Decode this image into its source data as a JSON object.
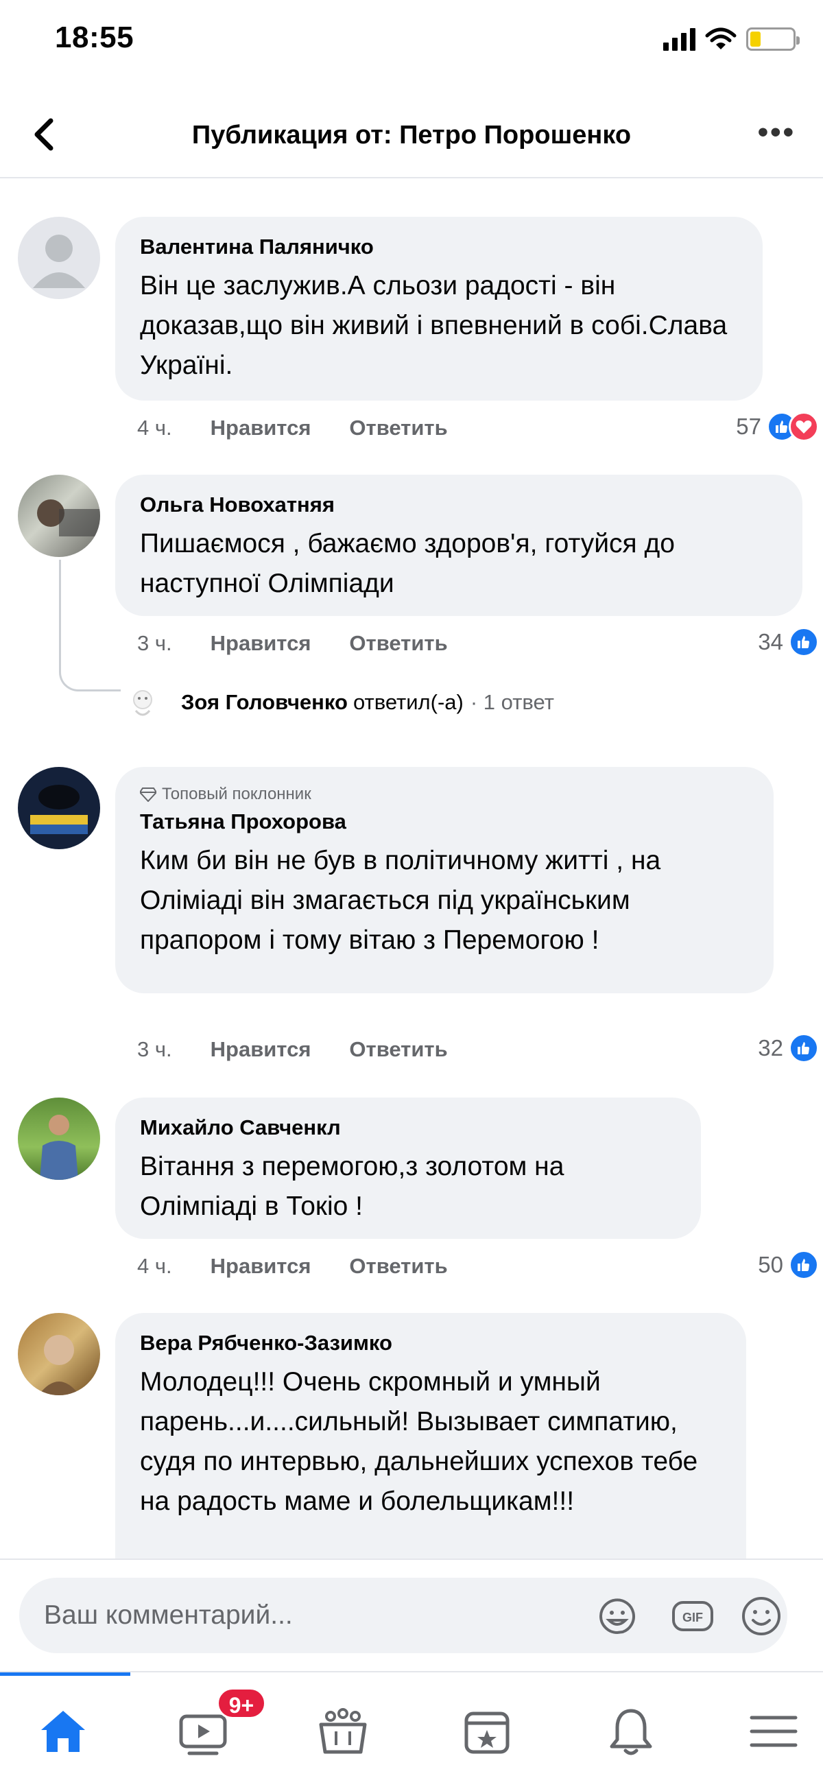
{
  "status_bar": {
    "time": "18:55",
    "battery_level": 0.25
  },
  "header": {
    "title": "Публикация от: Петро Порошенко"
  },
  "comments": [
    {
      "author": "Валентина Паляничко",
      "text": "Він це заслужив.А сльози радості - він доказав,що він живий і впевнений в собі.Слава Україні.",
      "time": "4 ч.",
      "like_label": "Нравится",
      "reply_label": "Ответить",
      "reactions": {
        "count": "57",
        "types": [
          "like",
          "love"
        ]
      }
    },
    {
      "author": "Ольга Новохатняя",
      "text": "Пишаємося  , бажаємо здоров'я, готуйся до наступної Олімпіади",
      "time": "3 ч.",
      "like_label": "Нравится",
      "reply_label": "Ответить",
      "reactions": {
        "count": "34",
        "types": [
          "like"
        ]
      },
      "reply_summary": {
        "name": "Зоя Головченко",
        "verb": "ответил(-а)",
        "count": "· 1 ответ"
      }
    },
    {
      "badge": "Топовый поклонник",
      "author": "Татьяна Прохорова",
      "text": "Ким би він не був в політичному житті , на Оліміаді він змагається під українським прапором і тому вітаю з Перемогою !",
      "time": "3 ч.",
      "like_label": "Нравится",
      "reply_label": "Ответить",
      "reactions": {
        "count": "32",
        "types": [
          "like"
        ]
      }
    },
    {
      "author": "Михайло Савченкл",
      "text": "Вітання з перемогою,з золотом на Олімпіаді в Токіо !",
      "time": "4 ч.",
      "like_label": "Нравится",
      "reply_label": "Ответить",
      "reactions": {
        "count": "50",
        "types": [
          "like"
        ]
      }
    },
    {
      "author": "Вера Рябченко-Зазимко",
      "text": "Молодец!!! Очень скромный и умный парень...и....сильный! Вызывает симпатию, судя по интервью, дальнейших успехов тебе на радость маме и болельщикам!!!"
    }
  ],
  "composer": {
    "placeholder": "Ваш комментарий...",
    "icons": [
      "sticker-icon",
      "gif-icon",
      "emoji-icon"
    ],
    "gif_label": "GIF"
  },
  "tabbar": {
    "tabs": [
      "home-icon",
      "video-icon",
      "groups-icon",
      "pages-icon",
      "bell-icon",
      "menu-icon"
    ],
    "video_badge": "9+",
    "active_tab": "home"
  },
  "colors": {
    "accent": "#1877f2",
    "bubble": "#f0f2f5",
    "secondary_text": "#65676b",
    "love": "#f33e58",
    "badge": "#e41e3f"
  }
}
